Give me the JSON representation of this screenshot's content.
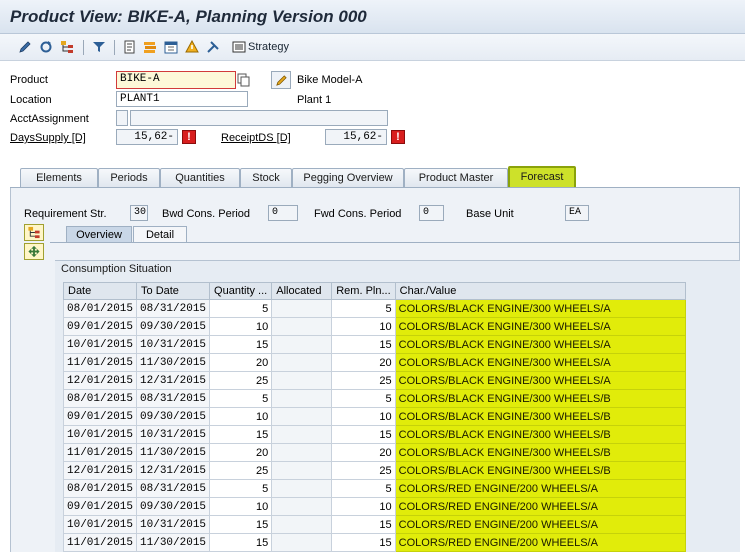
{
  "window": {
    "title": "Product View: BIKE-A, Planning Version 000"
  },
  "toolbar": {
    "strategy_label": "Strategy"
  },
  "form": {
    "product_label": "Product",
    "product_value": "BIKE-A",
    "product_desc_label": "Bike Model-A",
    "location_label": "Location",
    "location_value": "PLANT1",
    "location_desc": "Plant 1",
    "acct_label": "AcctAssignment",
    "dayssupply_label": "DaysSupply [D]",
    "dayssupply_value": "15,62-",
    "receiptds_label": "ReceiptDS [D]",
    "receiptds_value": "15,62-",
    "alert_glyph": "!"
  },
  "tabs": [
    {
      "label": "Elements"
    },
    {
      "label": "Periods"
    },
    {
      "label": "Quantities"
    },
    {
      "label": "Stock"
    },
    {
      "label": "Pegging Overview"
    },
    {
      "label": "Product Master"
    },
    {
      "label": "Forecast"
    }
  ],
  "forecast": {
    "req_str_label": "Requirement Str.",
    "req_str_value": "30",
    "bwd_label": "Bwd Cons. Period",
    "bwd_value": "0",
    "fwd_label": "Fwd Cons. Period",
    "fwd_value": "0",
    "base_unit_label": "Base Unit",
    "base_unit_value": "EA"
  },
  "subtabs": [
    {
      "label": "Overview"
    },
    {
      "label": "Detail"
    }
  ],
  "group_title": "Consumption Situation",
  "columns": [
    "Date",
    "To Date",
    "Quantity ...",
    "Allocated",
    "Rem. Pln...",
    "Char./Value"
  ],
  "rows": [
    [
      "08/01/2015",
      "08/31/2015",
      "5",
      "",
      "5",
      "COLORS/BLACK ENGINE/300 WHEELS/A"
    ],
    [
      "09/01/2015",
      "09/30/2015",
      "10",
      "",
      "10",
      "COLORS/BLACK ENGINE/300 WHEELS/A"
    ],
    [
      "10/01/2015",
      "10/31/2015",
      "15",
      "",
      "15",
      "COLORS/BLACK ENGINE/300 WHEELS/A"
    ],
    [
      "11/01/2015",
      "11/30/2015",
      "20",
      "",
      "20",
      "COLORS/BLACK ENGINE/300 WHEELS/A"
    ],
    [
      "12/01/2015",
      "12/31/2015",
      "25",
      "",
      "25",
      "COLORS/BLACK ENGINE/300 WHEELS/A"
    ],
    [
      "08/01/2015",
      "08/31/2015",
      "5",
      "",
      "5",
      "COLORS/BLACK ENGINE/300 WHEELS/B"
    ],
    [
      "09/01/2015",
      "09/30/2015",
      "10",
      "",
      "10",
      "COLORS/BLACK ENGINE/300 WHEELS/B"
    ],
    [
      "10/01/2015",
      "10/31/2015",
      "15",
      "",
      "15",
      "COLORS/BLACK ENGINE/300 WHEELS/B"
    ],
    [
      "11/01/2015",
      "11/30/2015",
      "20",
      "",
      "20",
      "COLORS/BLACK ENGINE/300 WHEELS/B"
    ],
    [
      "12/01/2015",
      "12/31/2015",
      "25",
      "",
      "25",
      "COLORS/BLACK ENGINE/300 WHEELS/B"
    ],
    [
      "08/01/2015",
      "08/31/2015",
      "5",
      "",
      "5",
      "COLORS/RED ENGINE/200 WHEELS/A"
    ],
    [
      "09/01/2015",
      "09/30/2015",
      "10",
      "",
      "10",
      "COLORS/RED ENGINE/200 WHEELS/A"
    ],
    [
      "10/01/2015",
      "10/31/2015",
      "15",
      "",
      "15",
      "COLORS/RED ENGINE/200 WHEELS/A"
    ],
    [
      "11/01/2015",
      "11/30/2015",
      "15",
      "",
      "15",
      "COLORS/RED ENGINE/200 WHEELS/A"
    ]
  ],
  "colors": {
    "highlight": "#e1ec0a",
    "active_tab": "#cde12a",
    "alert": "#d81e1e"
  }
}
